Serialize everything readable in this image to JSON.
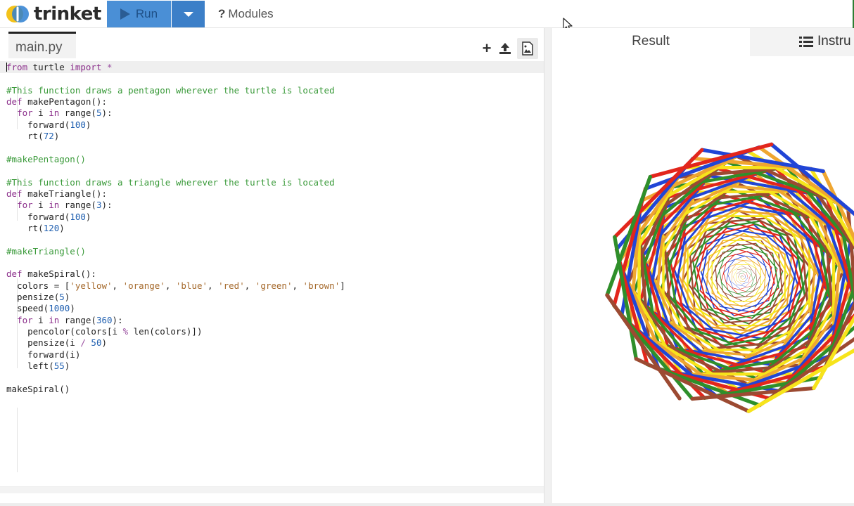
{
  "app": {
    "logo_text": "trinket",
    "run_label": "Run",
    "modules_label": "Modules"
  },
  "editor": {
    "file_tab": "main.py",
    "lines": [
      "from turtle import *",
      "",
      "#This function draws a pentagon wherever the turtle is located",
      "def makePentagon():",
      "  for i in range(5):",
      "    forward(100)",
      "    rt(72)",
      "",
      "#makePentagon()",
      "",
      "#This function draws a triangle wherever the turtle is located",
      "def makeTriangle():",
      "  for i in range(3):",
      "    forward(100)",
      "    rt(120)",
      "",
      "#makeTriangle()",
      "",
      "def makeSpiral():",
      "  colors = ['yellow', 'orange', 'blue', 'red', 'green', 'brown']",
      "  pensize(5)",
      "  speed(1000)",
      "  for i in range(360):",
      "    pencolor(colors[i % len(colors)])",
      "    pensize(i / 50)",
      "    forward(i)",
      "    left(55)",
      "",
      "makeSpiral()"
    ]
  },
  "result": {
    "tab_result": "Result",
    "tab_instructions": "Instru"
  },
  "turtle": {
    "colors": [
      "#f7e41b",
      "#efa630",
      "#2145d6",
      "#e2261c",
      "#2f8f2a",
      "#9c4a32"
    ],
    "steps": 360,
    "turn_degrees": 55
  },
  "colors": {
    "run_button": "#4a8fd6",
    "run_dropdown": "#3c7fc8",
    "keyword": "#8b2f8b",
    "comment": "#3a9a3a",
    "string": "#a5692b",
    "number": "#1f5fb0"
  }
}
